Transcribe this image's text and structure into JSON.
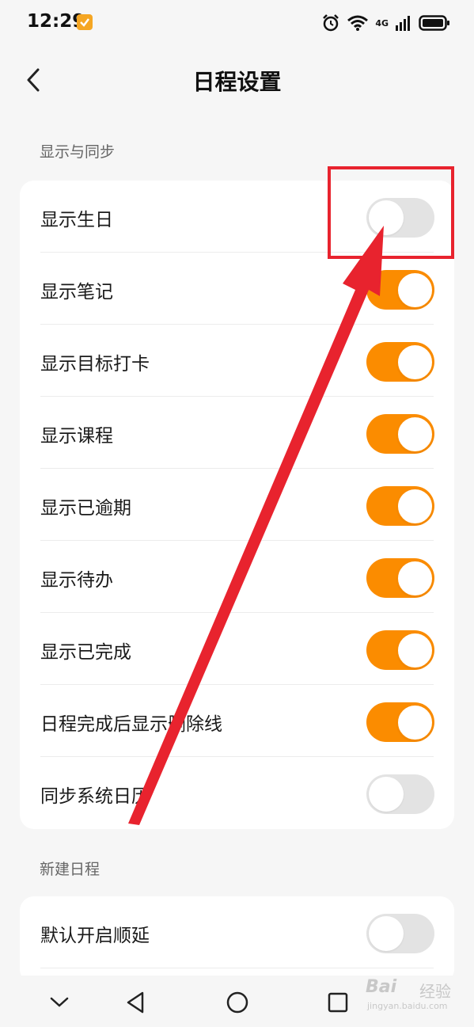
{
  "status_bar": {
    "time": "12:29",
    "network": "4G"
  },
  "header": {
    "title": "日程设置"
  },
  "sections": [
    {
      "title": "显示与同步",
      "items": [
        {
          "label": "显示生日",
          "on": false
        },
        {
          "label": "显示笔记",
          "on": true
        },
        {
          "label": "显示目标打卡",
          "on": true
        },
        {
          "label": "显示课程",
          "on": true
        },
        {
          "label": "显示已逾期",
          "on": true
        },
        {
          "label": "显示待办",
          "on": true
        },
        {
          "label": "显示已完成",
          "on": true
        },
        {
          "label": "日程完成后显示删除线",
          "on": true
        },
        {
          "label": "同步系统日历",
          "on": false
        }
      ]
    },
    {
      "title": "新建日程",
      "items": [
        {
          "label": "默认开启顺延",
          "on": false
        }
      ]
    }
  ],
  "colors": {
    "accent": "#fb8c00",
    "toggle_off": "#e3e3e3",
    "annotation": "#e8232e"
  },
  "watermark": {
    "brand": "Bai",
    "cn": "经验",
    "url": "jingyan.baidu.com"
  }
}
